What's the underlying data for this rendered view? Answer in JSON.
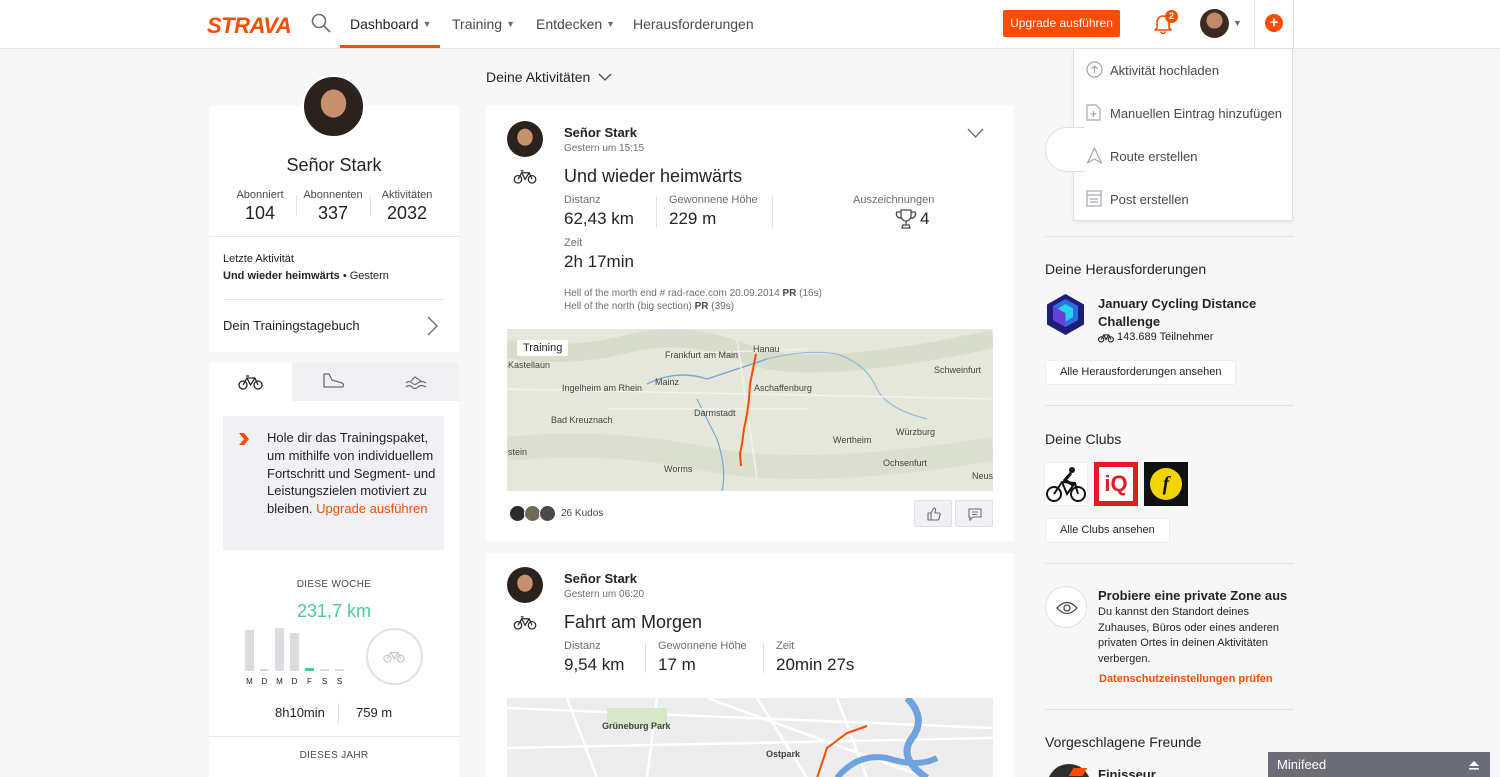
{
  "header": {
    "logo": "STRAVA",
    "nav": [
      {
        "label": "Dashboard",
        "has_menu": true
      },
      {
        "label": "Training",
        "has_menu": true
      },
      {
        "label": "Entdecken",
        "has_menu": true
      },
      {
        "label": "Herausforderungen",
        "has_menu": false
      }
    ],
    "upgrade_label": "Upgrade ausführen",
    "notification_count": "2",
    "accent": "#fc4c02"
  },
  "dropdown": {
    "items": [
      {
        "label": "Aktivität hochladen",
        "icon": "upload-icon"
      },
      {
        "label": "Manuellen Eintrag hinzufügen",
        "icon": "manual-entry-icon"
      },
      {
        "label": "Route erstellen",
        "icon": "route-icon"
      },
      {
        "label": "Post erstellen",
        "icon": "post-icon"
      }
    ]
  },
  "profile": {
    "name": "Señor Stark",
    "stats": [
      {
        "label": "Abonniert",
        "value": "104"
      },
      {
        "label": "Abonnenten",
        "value": "337"
      },
      {
        "label": "Aktivitäten",
        "value": "2032"
      }
    ],
    "last_activity_label": "Letzte Aktivität",
    "last_activity_name": "Und wieder heimwärts",
    "last_activity_when": " • Gestern",
    "diary_label": "Dein Trainingstagebuch"
  },
  "training": {
    "promo_text": "Hole dir das Trainingspaket, um mithilfe von individuellem Fortschritt und Segment- und Leistungszielen motiviert zu bleiben. ",
    "promo_link": "Upgrade ausführen",
    "week_label": "DIESE WOCHE",
    "week_distance": "231,7 km",
    "days": [
      "M",
      "D",
      "M",
      "D",
      "F",
      "S",
      "S"
    ],
    "week_time": "8h10min",
    "week_elevation": "759 m",
    "year_label": "DIESES JAHR"
  },
  "feed": {
    "title": "Deine Aktivitäten",
    "activities": [
      {
        "athlete": "Señor Stark",
        "time": "Gestern um 15:15",
        "title": "Und wieder heimwärts",
        "metrics": [
          {
            "label": "Distanz",
            "value": "62,43 km"
          },
          {
            "label": "Gewonnene Höhe",
            "value": "229 m"
          },
          {
            "label": "Zeit",
            "value": "2h 17min"
          }
        ],
        "achievements_label": "Auszeichnungen",
        "achievements_value": "4",
        "segments": [
          {
            "text": "Hell of the morth end # rad-race.com 20.09.2014 ",
            "pr": "PR",
            "time": " (16s)"
          },
          {
            "text": "Hell of the north (big section) ",
            "pr": "PR",
            "time": " (39s)"
          }
        ],
        "map_badge": "Training",
        "map_labels": [
          "Frankfurt am Main",
          "Hanau",
          "Kastellaun",
          "Mainz",
          "Ingelheim am Rhein",
          "Aschaffenburg",
          "Schweinfurt",
          "Darmstadt",
          "Bad Kreuznach",
          "Wertheim",
          "Würzburg",
          "Ochsenfurt",
          "Worms",
          "stein",
          "Neus"
        ],
        "kudos": "26 Kudos"
      },
      {
        "athlete": "Señor Stark",
        "time": "Gestern um 06:20",
        "title": "Fahrt am Morgen",
        "metrics": [
          {
            "label": "Distanz",
            "value": "9,54 km"
          },
          {
            "label": "Gewonnene Höhe",
            "value": "17 m"
          },
          {
            "label": "Zeit",
            "value": "20min 27s"
          }
        ],
        "map_labels": [
          "Grüneburg Park",
          "Ostpark"
        ]
      }
    ]
  },
  "sidebar": {
    "challenges_title": "Deine Herausforderungen",
    "challenge_name": "January Cycling Distance Challenge",
    "challenge_participants": "143.689 Teilnehmer",
    "challenges_button": "Alle Herausforderungen ansehen",
    "clubs_title": "Deine Clubs",
    "clubs_button": "Alle Clubs ansehen",
    "privacy_title": "Probiere eine private Zone aus",
    "privacy_text": "Du kannst den Standort deines Zuhauses, Büros oder eines anderen privaten Ortes in deinen Aktivitäten verbergen.",
    "privacy_link": "Datenschutzeinstellungen prüfen",
    "friends_title": "Vorgeschlagene Freunde",
    "friend_name": "Finisseur"
  },
  "minifeed": {
    "label": "Minifeed"
  }
}
